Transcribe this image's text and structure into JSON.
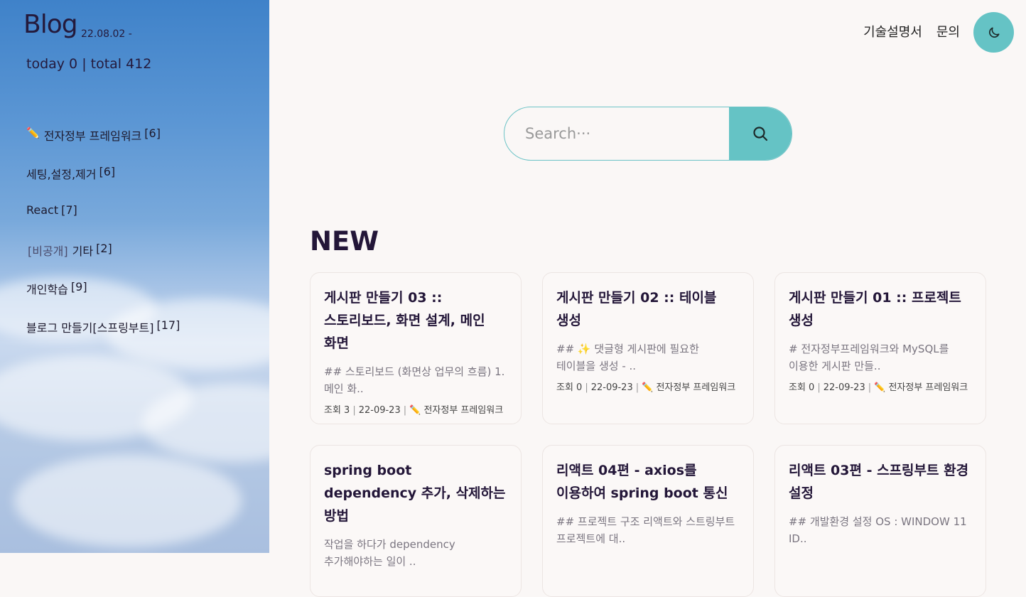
{
  "sidebar": {
    "blog_title": "Blog",
    "date_range": "22.08.02 -",
    "visitors": "today 0 | total 412",
    "categories": [
      {
        "icon": "pencil-icon",
        "label": "전자정부 프레임워크",
        "count": "[6]"
      },
      {
        "label": "세팅,설정,제거",
        "count": "[6]"
      },
      {
        "label": "React",
        "count": "[7]"
      },
      {
        "prefix": "[비공개]",
        "label": "기타",
        "count": "[2]"
      },
      {
        "label": "개인학습",
        "count": "[9]"
      },
      {
        "label": "블로그 만들기[스프링부트]",
        "count": "[17]"
      }
    ]
  },
  "header": {
    "links": [
      "기술설명서",
      "문의"
    ],
    "theme_toggle_icon": "moon-icon"
  },
  "search": {
    "placeholder": "Search···",
    "button_icon": "search-icon"
  },
  "main": {
    "section_title": "NEW",
    "posts": [
      {
        "title": "게시판 만들기 03 :: 스토리보드, 화면 설계, 메인 화면",
        "summary": "## 스토리보드 (화면상 업무의 흐름) 1. 메인 화..",
        "views": "조회 3",
        "date": "22-09-23",
        "category": "전자정부 프레임워크"
      },
      {
        "title": "게시판 만들기 02 :: 테이블 생성",
        "summary": "## ✨ 댓글형 게시판에 필요한 테이블을 생성 - ..",
        "views": "조회 0",
        "date": "22-09-23",
        "category": "전자정부 프레임워크"
      },
      {
        "title": "게시판 만들기 01 :: 프로젝트 생성",
        "summary": "# 전자정부프레임워크와 MySQL를 이용한 게시판 만들..",
        "views": "조회 0",
        "date": "22-09-23",
        "category": "전자정부 프레임워크"
      },
      {
        "title": "spring boot dependency 추가, 삭제하는 방법",
        "summary": "작업을 하다가 dependency 추가해야하는 일이 ..",
        "views": "",
        "date": "",
        "category": ""
      },
      {
        "title": "리액트 04편 - axios를 이용하여 spring boot 통신",
        "summary": "## 프로젝트 구조 리액트와 스트링부트 프로젝트에 대..",
        "views": "",
        "date": "",
        "category": ""
      },
      {
        "title": "리액트 03편 - 스프링부트 환경 설정",
        "summary": "## 개발환경 설정 OS : WINDOW 11 ID..",
        "views": "",
        "date": "",
        "category": ""
      }
    ]
  },
  "colors": {
    "accent": "#65c3c5",
    "heading": "#231638"
  }
}
